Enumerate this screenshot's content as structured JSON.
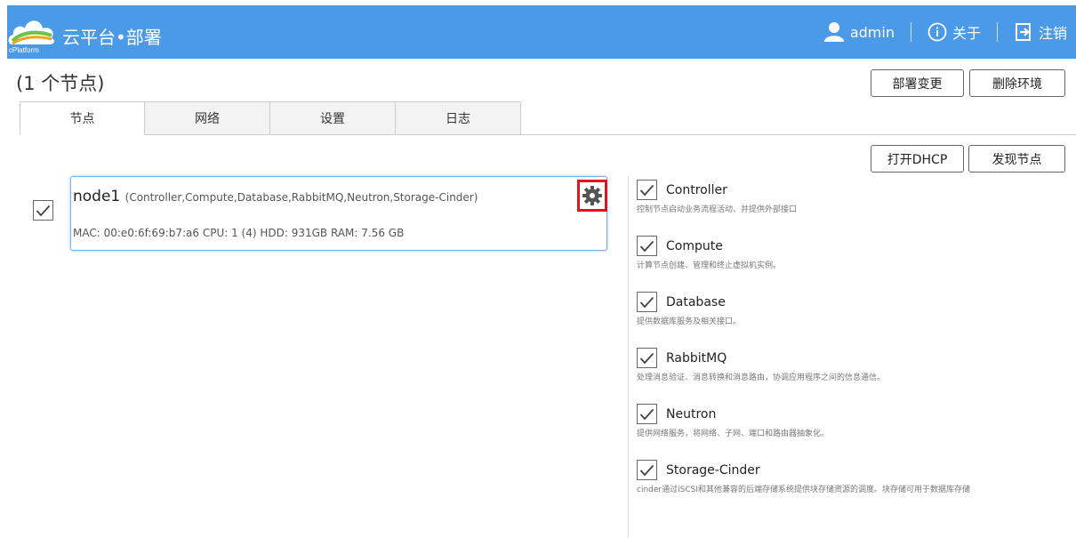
{
  "header": {
    "logo_text": "cPlatform",
    "title": "云平台•部署",
    "user": "admin",
    "about": "关于",
    "logout": "注销"
  },
  "node_count": "(1 个节点)",
  "actions": {
    "change_deploy": "部署变更",
    "delete_env": "删除环境",
    "open_dhcp": "打开DHCP",
    "discover_nodes": "发现节点"
  },
  "tabs": [
    {
      "label": "节点",
      "active": true
    },
    {
      "label": "网络",
      "active": false
    },
    {
      "label": "设置",
      "active": false
    },
    {
      "label": "日志",
      "active": false
    }
  ],
  "node": {
    "name": "node1",
    "roles": "(Controller,Compute,Database,RabbitMQ,Neutron,Storage-Cinder)",
    "specs": "MAC: 00:e0:6f:69:b7:a6 CPU: 1 (4) HDD: 931GB RAM: 7.56 GB",
    "checked": true
  },
  "roles": [
    {
      "name": "Controller",
      "desc": "控制节点启动业务流程活动、并提供外部接口",
      "checked": true
    },
    {
      "name": "Compute",
      "desc": "计算节点创建、管理和终止虚拟机实例。",
      "checked": true
    },
    {
      "name": "Database",
      "desc": "提供数据库服务及相关接口。",
      "checked": true
    },
    {
      "name": "RabbitMQ",
      "desc": "处理消息验证、消息转换和消息路由，协调应用程序之间的信息通信。",
      "checked": true
    },
    {
      "name": "Neutron",
      "desc": "提供网络服务，将网络、子网、端口和路由器抽象化。",
      "checked": true
    },
    {
      "name": "Storage-Cinder",
      "desc": "cinder通过iSCSI和其他兼容的后端存储系统提供块存储资源的调度。块存储可用于数据库存储",
      "checked": true
    }
  ],
  "colors": {
    "header_bg": "#4a9ae8",
    "highlight": "#e0141e",
    "card_border": "#7fb0e2"
  }
}
